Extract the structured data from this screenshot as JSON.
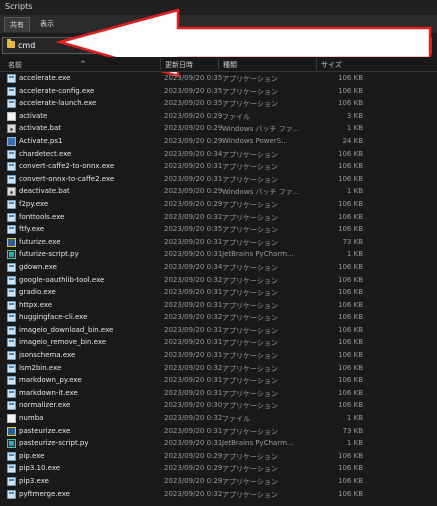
{
  "window": {
    "title": "Scripts"
  },
  "ribbon": {
    "tabs": [
      {
        "label": "共有",
        "active": true
      },
      {
        "label": "表示",
        "active": false
      }
    ]
  },
  "address": {
    "value": "cmd"
  },
  "columns": {
    "name": "名前",
    "date": "更新日時",
    "type": "種類",
    "size": "サイズ"
  },
  "files": [
    {
      "name": "accelerate.exe",
      "date": "2023/09/20 0:35",
      "type": "アプリケーション",
      "size": "106 KB",
      "icon": "exe"
    },
    {
      "name": "accelerate-config.exe",
      "date": "2023/09/20 0:35",
      "type": "アプリケーション",
      "size": "106 KB",
      "icon": "exe"
    },
    {
      "name": "accelerate-launch.exe",
      "date": "2023/09/20 0:35",
      "type": "アプリケーション",
      "size": "106 KB",
      "icon": "exe"
    },
    {
      "name": "activate",
      "date": "2023/09/20 0:29",
      "type": "ファイル",
      "size": "3 KB",
      "icon": "file"
    },
    {
      "name": "activate.bat",
      "date": "2023/09/20 0:29",
      "type": "Windows バッチ ファ...",
      "size": "1 KB",
      "icon": "bat"
    },
    {
      "name": "Activate.ps1",
      "date": "2023/09/20 0:29",
      "type": "Windows PowerS...",
      "size": "24 KB",
      "icon": "ps1"
    },
    {
      "name": "chardetect.exe",
      "date": "2023/09/20 0:34",
      "type": "アプリケーション",
      "size": "106 KB",
      "icon": "exe"
    },
    {
      "name": "convert-caffe2-to-onnx.exe",
      "date": "2023/09/20 0:31",
      "type": "アプリケーション",
      "size": "106 KB",
      "icon": "exe"
    },
    {
      "name": "convert-onnx-to-caffe2.exe",
      "date": "2023/09/20 0:31",
      "type": "アプリケーション",
      "size": "106 KB",
      "icon": "exe"
    },
    {
      "name": "deactivate.bat",
      "date": "2023/09/20 0:29",
      "type": "Windows バッチ ファ...",
      "size": "1 KB",
      "icon": "bat"
    },
    {
      "name": "f2py.exe",
      "date": "2023/09/20 0:29",
      "type": "アプリケーション",
      "size": "106 KB",
      "icon": "exe"
    },
    {
      "name": "fonttools.exe",
      "date": "2023/09/20 0:32",
      "type": "アプリケーション",
      "size": "106 KB",
      "icon": "exe"
    },
    {
      "name": "ftfy.exe",
      "date": "2023/09/20 0:35",
      "type": "アプリケーション",
      "size": "106 KB",
      "icon": "exe"
    },
    {
      "name": "futurize.exe",
      "date": "2023/09/20 0:31",
      "type": "アプリケーション",
      "size": "73 KB",
      "icon": "pyexe"
    },
    {
      "name": "futurize-script.py",
      "date": "2023/09/20 0:31",
      "type": "JetBrains PyCharm...",
      "size": "1 KB",
      "icon": "py"
    },
    {
      "name": "gdown.exe",
      "date": "2023/09/20 0:34",
      "type": "アプリケーション",
      "size": "106 KB",
      "icon": "exe"
    },
    {
      "name": "google-oauthlib-tool.exe",
      "date": "2023/09/20 0:32",
      "type": "アプリケーション",
      "size": "106 KB",
      "icon": "exe"
    },
    {
      "name": "gradio.exe",
      "date": "2023/09/20 0:31",
      "type": "アプリケーション",
      "size": "106 KB",
      "icon": "exe"
    },
    {
      "name": "httpx.exe",
      "date": "2023/09/20 0:31",
      "type": "アプリケーション",
      "size": "106 KB",
      "icon": "exe"
    },
    {
      "name": "huggingface-cli.exe",
      "date": "2023/09/20 0:32",
      "type": "アプリケーション",
      "size": "106 KB",
      "icon": "exe"
    },
    {
      "name": "imageio_download_bin.exe",
      "date": "2023/09/20 0:31",
      "type": "アプリケーション",
      "size": "106 KB",
      "icon": "exe"
    },
    {
      "name": "imageio_remove_bin.exe",
      "date": "2023/09/20 0:31",
      "type": "アプリケーション",
      "size": "106 KB",
      "icon": "exe"
    },
    {
      "name": "jsonschema.exe",
      "date": "2023/09/20 0:31",
      "type": "アプリケーション",
      "size": "106 KB",
      "icon": "exe"
    },
    {
      "name": "lsm2bin.exe",
      "date": "2023/09/20 0:32",
      "type": "アプリケーション",
      "size": "106 KB",
      "icon": "exe"
    },
    {
      "name": "markdown_py.exe",
      "date": "2023/09/20 0:31",
      "type": "アプリケーション",
      "size": "106 KB",
      "icon": "exe"
    },
    {
      "name": "markdown-it.exe",
      "date": "2023/09/20 0:31",
      "type": "アプリケーション",
      "size": "106 KB",
      "icon": "exe"
    },
    {
      "name": "normalizer.exe",
      "date": "2023/09/20 0:30",
      "type": "アプリケーション",
      "size": "106 KB",
      "icon": "exe"
    },
    {
      "name": "numba",
      "date": "2023/09/20 0:32",
      "type": "ファイル",
      "size": "1 KB",
      "icon": "file"
    },
    {
      "name": "pasteurize.exe",
      "date": "2023/09/20 0:31",
      "type": "アプリケーション",
      "size": "73 KB",
      "icon": "pyexe"
    },
    {
      "name": "pasteurize-script.py",
      "date": "2023/09/20 0:31",
      "type": "JetBrains PyCharm...",
      "size": "1 KB",
      "icon": "py"
    },
    {
      "name": "pip.exe",
      "date": "2023/09/20 0:29",
      "type": "アプリケーション",
      "size": "106 KB",
      "icon": "exe"
    },
    {
      "name": "pip3.10.exe",
      "date": "2023/09/20 0:29",
      "type": "アプリケーション",
      "size": "106 KB",
      "icon": "exe"
    },
    {
      "name": "pip3.exe",
      "date": "2023/09/20 0:29",
      "type": "アプリケーション",
      "size": "106 KB",
      "icon": "exe"
    },
    {
      "name": "pyftmerge.exe",
      "date": "2023/09/20 0:32",
      "type": "アプリケーション",
      "size": "106 KB",
      "icon": "exe"
    }
  ]
}
